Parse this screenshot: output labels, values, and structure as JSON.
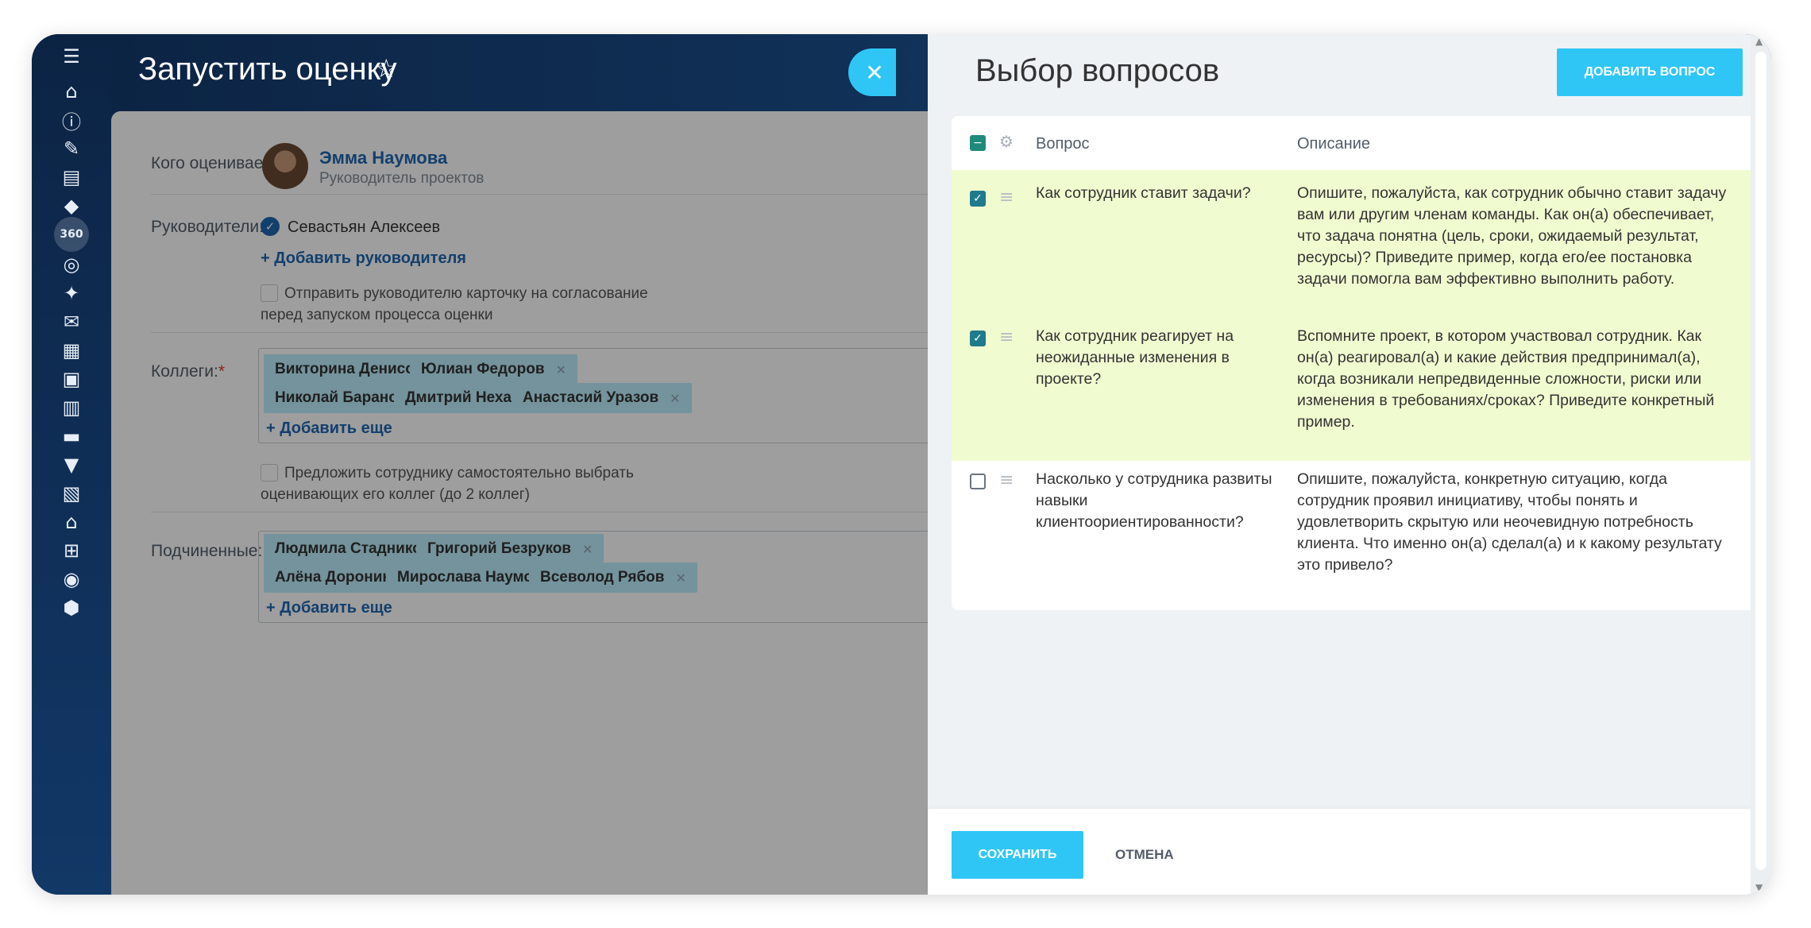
{
  "header": {
    "title": "Запустить оценку",
    "star_icon": "☆",
    "close_icon": "✕"
  },
  "rail_icons": [
    "menu-icon",
    "home-icon",
    "info-icon",
    "tasks-icon",
    "docs-icon",
    "education-icon",
    "assessment-360-icon",
    "target-icon",
    "games-icon",
    "chat-icon",
    "stats-icon",
    "cards-icon",
    "calendar-icon",
    "crm-icon",
    "filter-icon",
    "planner-icon",
    "shop-icon",
    "cart-icon",
    "goal-icon",
    "shield-icon"
  ],
  "form": {
    "who_label": "Кого оцениваем:",
    "person_name": "Эмма Наумова",
    "person_position": "Руководитель проектов",
    "managers_label": "Руководители:",
    "manager_name": "Севастьян Алексеев",
    "add_manager": "+ Добавить руководителя",
    "approval_note": "Отправить руководителю карточку на согласование перед запуском процесса оценки",
    "colleagues_label": "Коллеги:",
    "colleagues": [
      "Викторина Денисова",
      "Юлиан Федоров",
      "Николай Баранов",
      "Дмитрий Нехай",
      "Анастасий Уразов"
    ],
    "add_more": "+ Добавить еще",
    "self_select_note": "Предложить сотруднику самостоятельно выбрать оценивающих его коллег (до 2 коллег)",
    "subordinates_label": "Подчиненные:",
    "subordinates": [
      "Людмила Стадникова",
      "Григорий Безруков",
      "Алёна Доронина",
      "Мирослава Наумова",
      "Всеволод Рябов"
    ],
    "add_more_2": "+ Добавить еще"
  },
  "panel": {
    "title": "Выбор вопросов",
    "add_question": "ДОБАВИТЬ ВОПРОС",
    "col_question": "Вопрос",
    "col_description": "Описание",
    "rows": [
      {
        "question": "Как сотрудник ставит задачи?",
        "description": "Опишите, пожалуйста, как сотрудник обычно ставит задачу вам или другим членам команды. Как он(а) обеспечивает, что задача понятна (цель, сроки, ожидаемый результат, ресурсы)? Приведите пример, когда его/ее постановка задачи помогла вам эффективно выполнить работу.",
        "checked": true
      },
      {
        "question": "Как сотрудник реагирует на неожиданные изменения в проекте?",
        "description": "Вспомните проект, в котором участвовал сотрудник. Как он(а) реагировал(а) и какие действия предпринимал(а), когда возникали непредвиденные сложности, риски или изменения в требованиях/сроках? Приведите конкретный пример.",
        "checked": true
      },
      {
        "question": "Насколько у сотрудника развиты навыки клиентоориентированности?",
        "description": "Опишите, пожалуйста, конкретную ситуацию, когда сотрудник проявил инициативу, чтобы понять и удовлетворить скрытую или неочевидную потребность клиента. Что именно он(а) сделал(а) и к какому результату это привело?",
        "checked": false
      }
    ],
    "save": "СОХРАНИТЬ",
    "cancel": "ОТМЕНА"
  },
  "colors": {
    "accent": "#2fc6f6",
    "selected_row": "#f1fbd0",
    "link": "#2067b0",
    "checkbox_on": "#1f7a8c"
  }
}
